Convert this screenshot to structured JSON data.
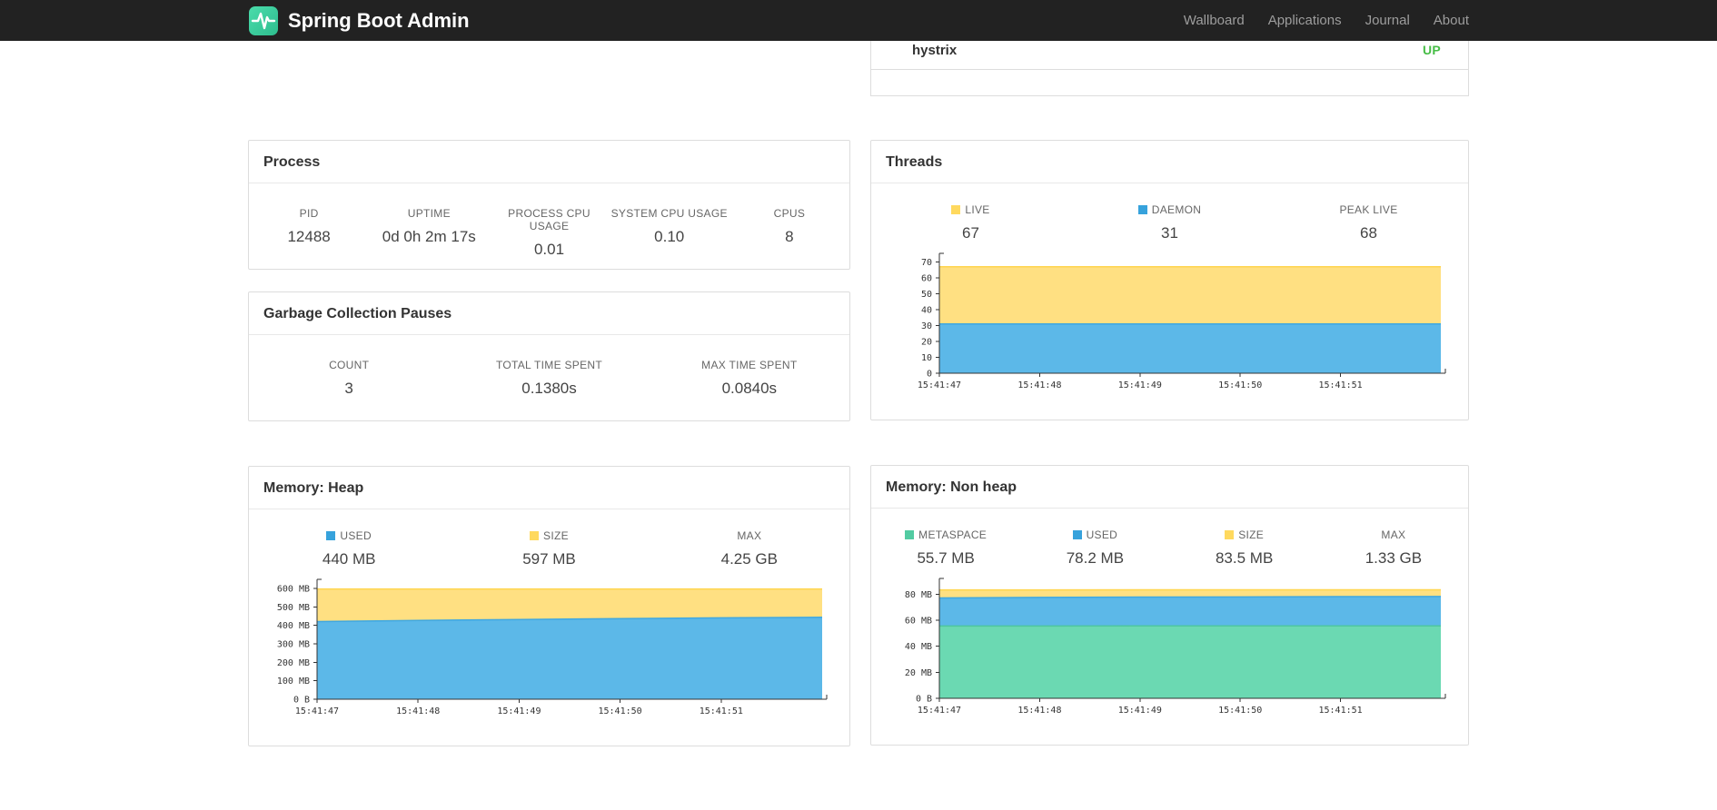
{
  "navbar": {
    "brand": "Spring Boot Admin",
    "links": [
      {
        "label": "Wallboard"
      },
      {
        "label": "Applications"
      },
      {
        "label": "Journal"
      },
      {
        "label": "About"
      }
    ]
  },
  "applications_panel": {
    "app_name": "hystrix",
    "status": "UP",
    "status_color": "#47BD47"
  },
  "process": {
    "title": "Process",
    "metrics": [
      {
        "label": "PID",
        "value": "12488"
      },
      {
        "label": "UPTIME",
        "value": "0d 0h 2m 17s"
      },
      {
        "label": "PROCESS CPU USAGE",
        "value": "0.01"
      },
      {
        "label": "SYSTEM CPU USAGE",
        "value": "0.10"
      },
      {
        "label": "CPUS",
        "value": "8"
      }
    ]
  },
  "gc": {
    "title": "Garbage Collection Pauses",
    "metrics": [
      {
        "label": "COUNT",
        "value": "3"
      },
      {
        "label": "TOTAL TIME SPENT",
        "value": "0.1380s"
      },
      {
        "label": "MAX TIME SPENT",
        "value": "0.0840s"
      }
    ]
  },
  "threads": {
    "title": "Threads",
    "legend": [
      {
        "label": "LIVE",
        "value": "67",
        "color": "#FFD95E"
      },
      {
        "label": "DAEMON",
        "value": "31",
        "color": "#36A2DC"
      },
      {
        "label": "PEAK LIVE",
        "value": "68"
      }
    ]
  },
  "heap": {
    "title": "Memory: Heap",
    "legend": [
      {
        "label": "USED",
        "value": "440 MB",
        "color": "#36A2DC"
      },
      {
        "label": "SIZE",
        "value": "597 MB",
        "color": "#FFD95E"
      },
      {
        "label": "MAX",
        "value": "4.25 GB"
      }
    ]
  },
  "nonheap": {
    "title": "Memory: Non heap",
    "legend": [
      {
        "label": "METASPACE",
        "value": "55.7 MB",
        "color": "#52CBA2"
      },
      {
        "label": "USED",
        "value": "78.2 MB",
        "color": "#36A2DC"
      },
      {
        "label": "SIZE",
        "value": "83.5 MB",
        "color": "#FFD95E"
      },
      {
        "label": "MAX",
        "value": "1.33 GB"
      }
    ]
  },
  "chart_data": {
    "threads": {
      "type": "area",
      "x_labels": [
        "15:41:47",
        "15:41:48",
        "15:41:49",
        "15:41:50",
        "15:41:51"
      ],
      "ylim": 72,
      "yticks": [
        {
          "v": 0,
          "label": "0"
        },
        {
          "v": 10,
          "label": "10"
        },
        {
          "v": 20,
          "label": "20"
        },
        {
          "v": 30,
          "label": "30"
        },
        {
          "v": 40,
          "label": "40"
        },
        {
          "v": 50,
          "label": "50"
        },
        {
          "v": 60,
          "label": "60"
        },
        {
          "v": 70,
          "label": "70"
        }
      ],
      "series": [
        {
          "name": "LIVE",
          "fill": "#FFE082",
          "stroke": "#FFD54F",
          "values": [
            67,
            67,
            67,
            67,
            67,
            67
          ]
        },
        {
          "name": "DAEMON",
          "fill": "#5CB8E8",
          "stroke": "#3FA7E0",
          "values": [
            31,
            31,
            31,
            31,
            31,
            31
          ]
        }
      ]
    },
    "heap": {
      "type": "area",
      "x_labels": [
        "15:41:47",
        "15:41:48",
        "15:41:49",
        "15:41:50",
        "15:41:51"
      ],
      "ylim": 620,
      "yticks": [
        {
          "v": 0,
          "label": "0 B"
        },
        {
          "v": 100,
          "label": "100 MB"
        },
        {
          "v": 200,
          "label": "200 MB"
        },
        {
          "v": 300,
          "label": "300 MB"
        },
        {
          "v": 400,
          "label": "400 MB"
        },
        {
          "v": 500,
          "label": "500 MB"
        },
        {
          "v": 600,
          "label": "600 MB"
        }
      ],
      "series": [
        {
          "name": "SIZE",
          "fill": "#FFE082",
          "stroke": "#FFD54F",
          "values": [
            597,
            597,
            597,
            597,
            597,
            597
          ]
        },
        {
          "name": "USED",
          "fill": "#5CB8E8",
          "stroke": "#3FA7E0",
          "values": [
            421,
            427,
            432,
            437,
            441,
            444
          ]
        }
      ]
    },
    "nonheap": {
      "type": "area",
      "x_labels": [
        "15:41:47",
        "15:41:48",
        "15:41:49",
        "15:41:50",
        "15:41:51"
      ],
      "ylim": 88,
      "yticks": [
        {
          "v": 0,
          "label": "0 B"
        },
        {
          "v": 20,
          "label": "20 MB"
        },
        {
          "v": 40,
          "label": "40 MB"
        },
        {
          "v": 60,
          "label": "60 MB"
        },
        {
          "v": 80,
          "label": "80 MB"
        }
      ],
      "series": [
        {
          "name": "SIZE",
          "fill": "#FFE082",
          "stroke": "#FFD54F",
          "values": [
            83.4,
            83.4,
            83.5,
            83.5,
            83.5,
            83.5
          ]
        },
        {
          "name": "USED",
          "fill": "#5CB8E8",
          "stroke": "#3FA7E0",
          "values": [
            77.2,
            77.6,
            77.9,
            78.0,
            78.2,
            78.3
          ]
        },
        {
          "name": "METASPACE",
          "fill": "#6BD9B2",
          "stroke": "#4EC79E",
          "values": [
            55.6,
            55.6,
            55.7,
            55.7,
            55.7,
            55.7
          ]
        }
      ]
    }
  }
}
